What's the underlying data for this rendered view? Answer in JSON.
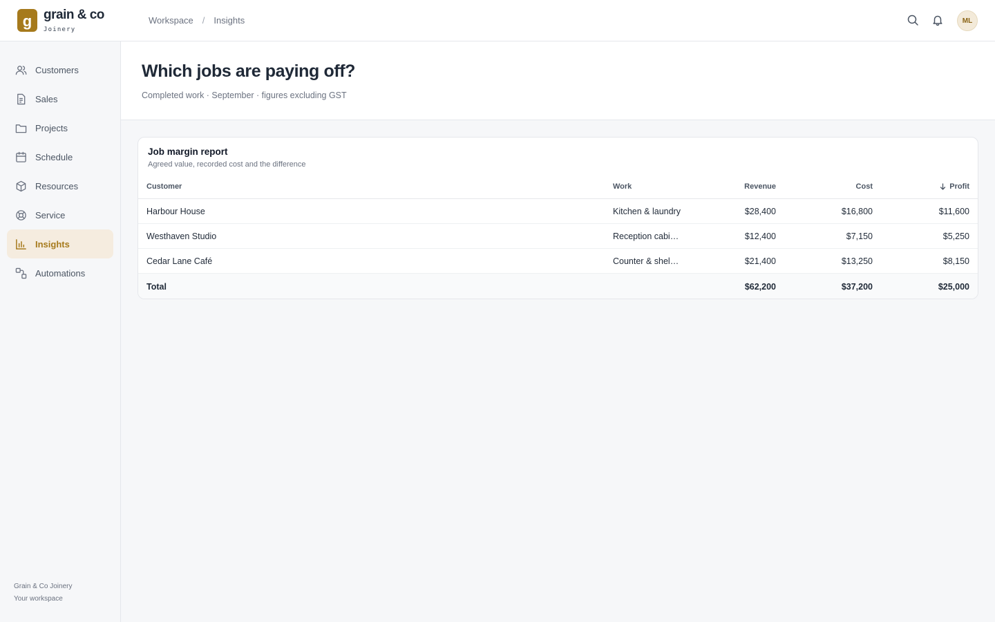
{
  "brand": {
    "mark": "g",
    "name": "grain & co",
    "sub": "Joinery"
  },
  "breadcrumb": [
    "Workspace",
    "Insights"
  ],
  "breadcrumb_separator": "/",
  "header_icons": [
    "search-icon",
    "bell-icon"
  ],
  "user": {
    "initials": "ML"
  },
  "sidebar": {
    "items": [
      {
        "label": "Customers",
        "icon": "users-icon"
      },
      {
        "label": "Sales",
        "icon": "document-icon"
      },
      {
        "label": "Projects",
        "icon": "folder-icon"
      },
      {
        "label": "Schedule",
        "icon": "calendar-icon"
      },
      {
        "label": "Resources",
        "icon": "box-icon"
      },
      {
        "label": "Service",
        "icon": "lifebuoy-icon"
      },
      {
        "label": "Insights",
        "icon": "bar-chart-icon",
        "active": true
      },
      {
        "label": "Automations",
        "icon": "automation-icon"
      }
    ],
    "footer": {
      "company": "Grain & Co Joinery",
      "workspace": "Your workspace"
    }
  },
  "page": {
    "title": "Which jobs are paying off?",
    "subtitle": "Completed work · September · figures excluding GST"
  },
  "report": {
    "title": "Job margin report",
    "subtitle": "Agreed value, recorded cost and the difference",
    "columns": {
      "customer": "Customer",
      "work": "Work",
      "revenue": "Revenue",
      "cost": "Cost",
      "profit": "Profit"
    },
    "sort": {
      "column": "Profit",
      "direction": "descending",
      "icon": "arrow-down-icon"
    },
    "rows": [
      {
        "customer": "Harbour House",
        "work": "Kitchen & laundry",
        "revenue": "$28,400",
        "cost": "$16,800",
        "profit": "$11,600"
      },
      {
        "customer": "Westhaven Studio",
        "work": "Reception cabinetry",
        "revenue": "$12,400",
        "cost": "$7,150",
        "profit": "$5,250"
      },
      {
        "customer": "Cedar Lane Café",
        "work": "Counter & shelving",
        "revenue": "$21,400",
        "cost": "$13,250",
        "profit": "$8,150"
      }
    ],
    "total": {
      "label": "Total",
      "revenue": "$62,200",
      "cost": "$37,200",
      "profit": "$25,000"
    }
  },
  "colors": {
    "accent": "#a67a1c",
    "active_bg": "#f5ecdf",
    "text": "#1f2937",
    "muted": "#6b7280"
  }
}
